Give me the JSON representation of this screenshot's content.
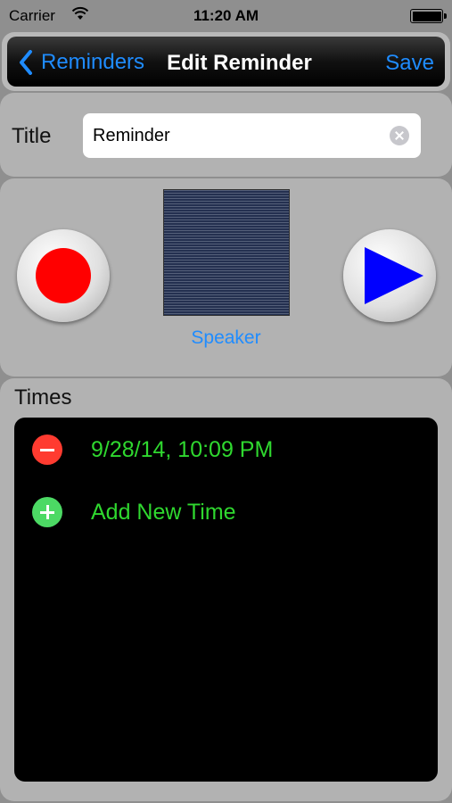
{
  "status_bar": {
    "carrier": "Carrier",
    "time": "11:20 AM"
  },
  "nav": {
    "back_label": "Reminders",
    "title": "Edit Reminder",
    "save_label": "Save"
  },
  "title_field": {
    "label": "Title",
    "value": "Reminder"
  },
  "audio": {
    "speaker_label": "Speaker"
  },
  "times": {
    "label": "Times",
    "entries": [
      {
        "text": "9/28/14, 10:09 PM"
      }
    ],
    "add_label": "Add New Time"
  },
  "colors": {
    "accent": "#1f8cff",
    "record": "#ff0000",
    "play": "#0000ff",
    "time_text": "#2fd82f",
    "delete": "#ff3b30",
    "add": "#4cd964"
  },
  "icons": {
    "wifi": "wifi-icon",
    "battery": "battery-icon",
    "back": "chevron-left-icon",
    "clear": "clear-icon",
    "record": "record-icon",
    "play": "play-icon",
    "delete": "minus-circle-icon",
    "add": "plus-circle-icon"
  }
}
